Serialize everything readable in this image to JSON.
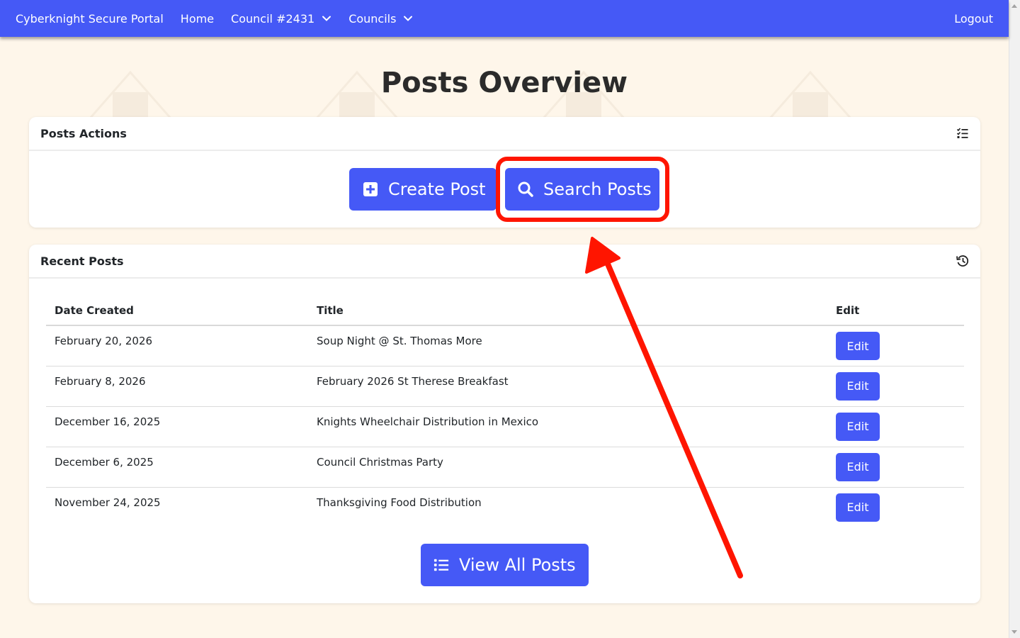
{
  "navbar": {
    "brand": "Cyberknight Secure Portal",
    "links": [
      {
        "label": "Home"
      },
      {
        "label": "Council #2431",
        "icon": "chevron-down-icon"
      },
      {
        "label": "Councils",
        "icon": "chevron-down-icon"
      }
    ],
    "logout": "Logout",
    "bg_color": "#4559f6"
  },
  "page": {
    "title": "Posts Overview",
    "background_color": "#fef6ea",
    "watermark_icon": "kofc-emblem-icon"
  },
  "actions_card": {
    "header": "Posts Actions",
    "header_icon": "list-check-icon",
    "create_button": {
      "label": "Create Post",
      "icon": "plus-square-icon"
    },
    "search_button": {
      "label": "Search Posts",
      "icon": "search-icon"
    }
  },
  "recent_card": {
    "header": "Recent Posts",
    "header_icon": "history-icon",
    "columns": [
      "Date Created",
      "Title",
      "Edit"
    ],
    "rows": [
      {
        "date": "February 20, 2026",
        "title": "Soup Night @ St. Thomas More",
        "edit": "Edit"
      },
      {
        "date": "February 8, 2026",
        "title": "February 2026 St Therese Breakfast",
        "edit": "Edit"
      },
      {
        "date": "December 16, 2025",
        "title": "Knights Wheelchair Distribution in Mexico",
        "edit": "Edit"
      },
      {
        "date": "December 6, 2025",
        "title": "Council Christmas Party",
        "edit": "Edit"
      },
      {
        "date": "November 24, 2025",
        "title": "Thanksgiving Food Distribution",
        "edit": "Edit"
      }
    ],
    "view_all_button": {
      "label": "View All Posts",
      "icon": "list-icon"
    }
  },
  "annotation": {
    "highlight_color": "#ff1500",
    "highlight_target": "search-posts-button"
  }
}
